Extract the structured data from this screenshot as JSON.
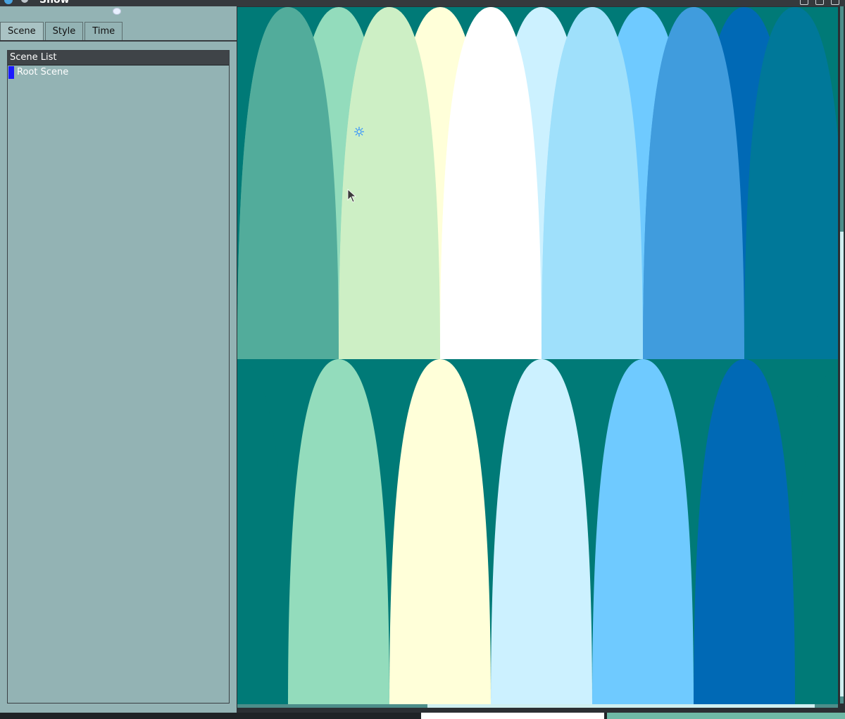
{
  "window": {
    "title": "Show"
  },
  "tabs": [
    {
      "label": "Scene",
      "active": true
    },
    {
      "label": "Style",
      "active": false
    },
    {
      "label": "Time",
      "active": false
    }
  ],
  "scene_list": {
    "header": "Scene List",
    "items": [
      {
        "label": "Root Scene",
        "selected": true
      }
    ]
  },
  "canvas": {
    "palette": {
      "teal": "#007a77",
      "mint": "#52ac9b",
      "seafoam": "#93dcbc",
      "pale_green": "#cdefc5",
      "cream": "#ffffd9",
      "white": "#ffffff",
      "ice": "#ccf1ff",
      "sky": "#9fe0fb",
      "light_blue": "#6fcaff",
      "mid_blue": "#409cdd",
      "deep_blue": "#0069b5",
      "ocean": "#007899"
    },
    "gizmo_icon": "transform-gizmo-icon",
    "cursor_icon": "mouse-pointer-icon"
  }
}
